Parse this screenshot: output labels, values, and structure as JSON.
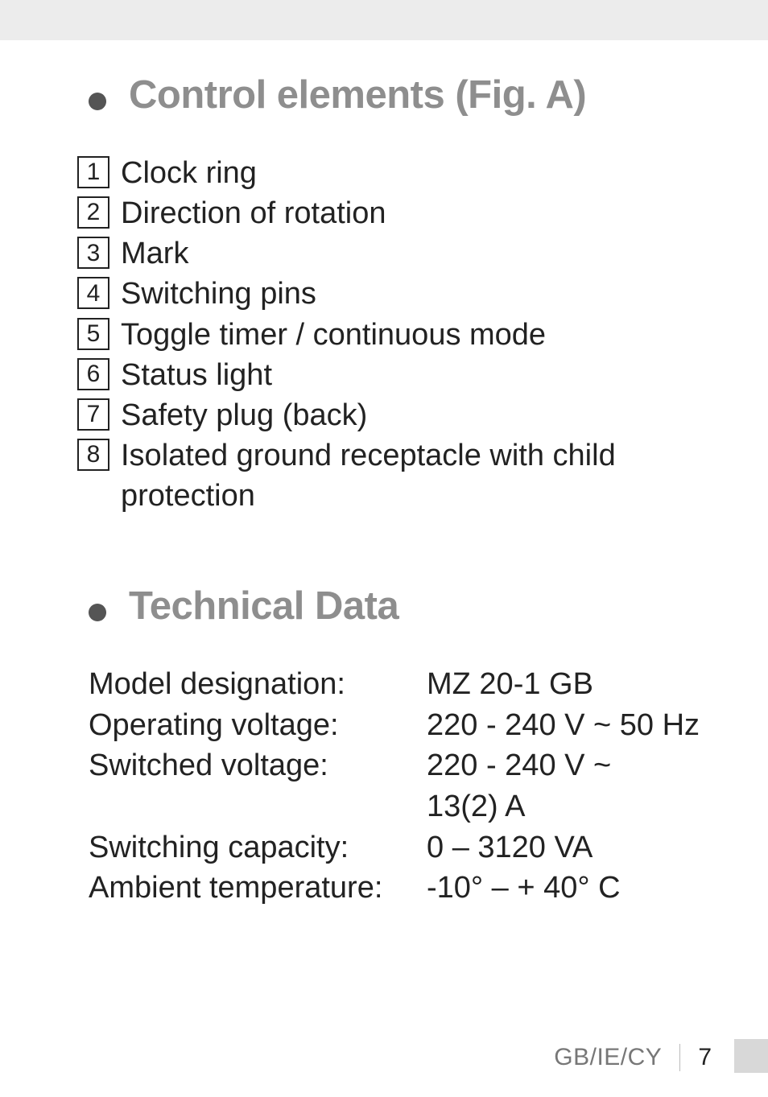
{
  "sections": {
    "control": {
      "heading": "Control elements (Fig. A)",
      "items": [
        {
          "num": "1",
          "label": "Clock ring"
        },
        {
          "num": "2",
          "label": "Direction of rotation"
        },
        {
          "num": "3",
          "label": "Mark"
        },
        {
          "num": "4",
          "label": "Switching pins"
        },
        {
          "num": "5",
          "label": "Toggle timer / continuous mode"
        },
        {
          "num": "6",
          "label": "Status light"
        },
        {
          "num": "7",
          "label": "Safety plug (back)"
        },
        {
          "num": "8",
          "label": "Isolated ground receptacle with child",
          "cont": "protection"
        }
      ]
    },
    "technical": {
      "heading": "Technical Data",
      "specs": [
        {
          "label": "Model designation:",
          "value": "MZ 20-1 GB"
        },
        {
          "label": "Operating voltage:",
          "value": "220 - 240 V ~ 50 Hz"
        },
        {
          "label": "Switched voltage:",
          "value": "220 - 240 V ~"
        },
        {
          "label": "",
          "value": "13(2) A"
        },
        {
          "label": "Switching capacity:",
          "value": "0 – 3120 VA"
        },
        {
          "label": "Ambient temperature:",
          "value": "-10° – + 40° C"
        }
      ]
    }
  },
  "footer": {
    "region": "GB/IE/CY",
    "page_number": "7"
  }
}
